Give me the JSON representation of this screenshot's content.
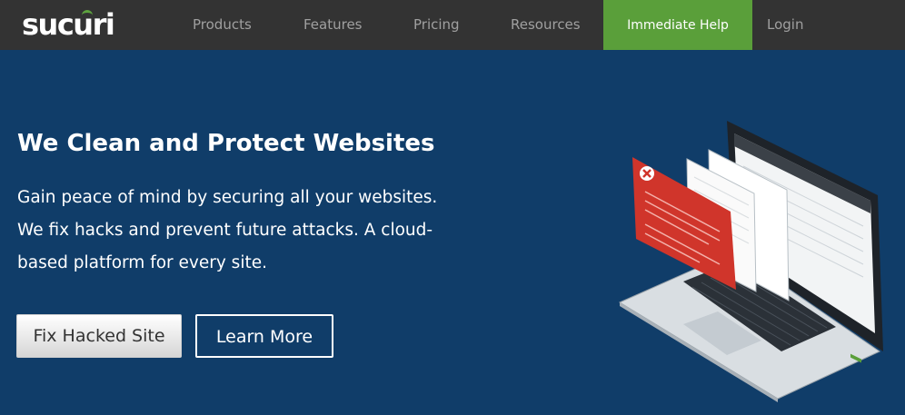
{
  "nav": {
    "logo_text": "sucuri",
    "links": {
      "products": "Products",
      "features": "Features",
      "pricing": "Pricing",
      "resources": "Resources",
      "login": "Login"
    },
    "cta_label": "Immediate Help"
  },
  "hero": {
    "title": "We Clean and Protect Websites",
    "line1": "Gain peace of mind by securing all your websites.",
    "line2": "We fix hacks and prevent future attacks. A cloud-",
    "line3": "based platform for every site.",
    "primary_button": "Fix Hacked Site",
    "secondary_button": "Learn More"
  },
  "illustration": {
    "name": "laptop-dashboard-illustration",
    "warning_icon": "close-x-icon"
  },
  "colors": {
    "nav_bg": "#333333",
    "hero_bg": "#103d69",
    "cta_green": "#5a9f3a",
    "nav_text": "#a0a0a0",
    "warning_red": "#d0352b"
  }
}
